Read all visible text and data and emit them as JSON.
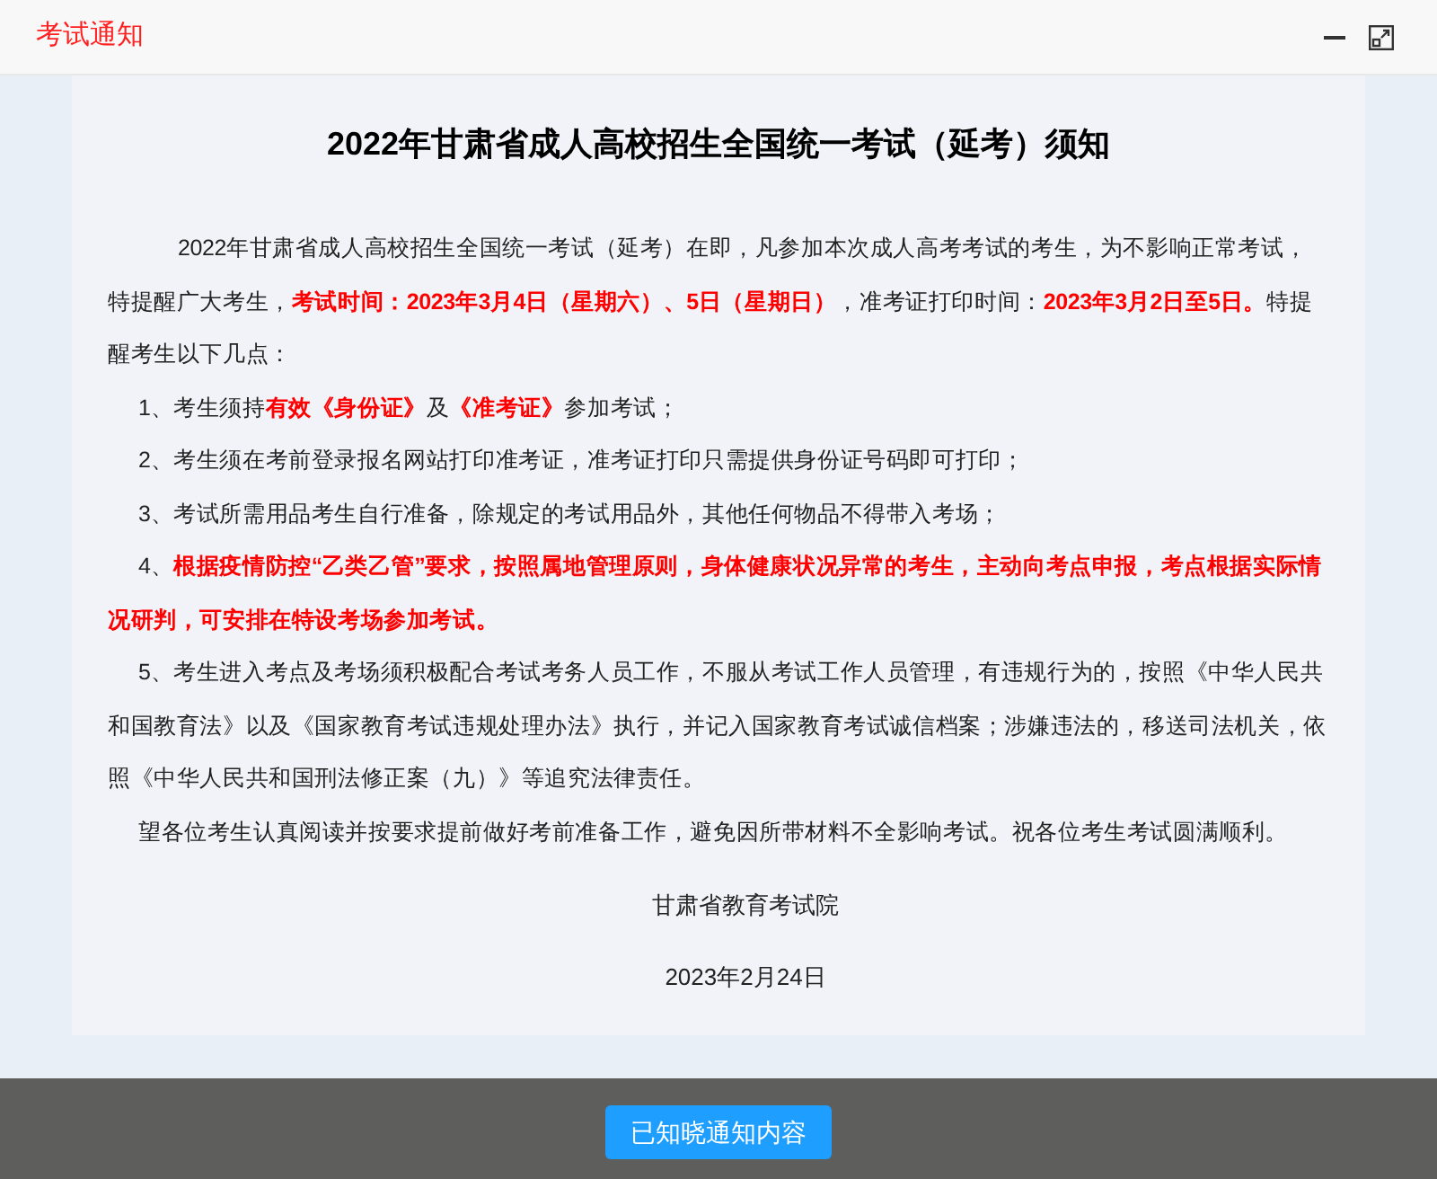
{
  "dialog": {
    "title": "考试通知",
    "controls": [
      {
        "kind": "minimize"
      },
      {
        "kind": "maximize"
      }
    ]
  },
  "notice": {
    "heading": "2022年甘肃省成人高校招生全国统一考试（延考）须知",
    "paragraphs": [
      {
        "kind": "intro",
        "segments": [
          {
            "text": "2022年甘肃省成人高校招生全国统一考试（延考）在即，凡参加本次成人高考考试的考生，为不影响正常考试，特提醒广大考生，",
            "red": false
          },
          {
            "text": "考试时间：2023年3月4日（星期六）、5日（星期日）",
            "red": true
          },
          {
            "text": "，准考证打印时间：",
            "red": false
          },
          {
            "text": "2023年3月2日至5日。",
            "red": true
          },
          {
            "text": "特提醒考生以下几点：",
            "red": false
          }
        ]
      },
      {
        "kind": "item",
        "segments": [
          {
            "text": "1、考生须持",
            "red": false
          },
          {
            "text": "有效《身份证》",
            "red": true
          },
          {
            "text": "及",
            "red": false
          },
          {
            "text": "《准考证》",
            "red": true
          },
          {
            "text": "参加考试；",
            "red": false
          }
        ]
      },
      {
        "kind": "item",
        "segments": [
          {
            "text": "2、考生须在考前登录报名网站打印准考证，准考证打印只需提供身份证号码即可打印；",
            "red": false
          }
        ]
      },
      {
        "kind": "item",
        "segments": [
          {
            "text": "3、考试所需用品考生自行准备，除规定的考试用品外，其他任何物品不得带入考场；",
            "red": false
          }
        ]
      },
      {
        "kind": "item",
        "segments": [
          {
            "text": "4、",
            "red": false
          },
          {
            "text": "根据疫情防控“乙类乙管”要求，按照属地管理原则，身体健康状况异常的考生，主动向考点申报，考点根据实际情况研判，可安排在特设考场参加考试。",
            "red": true
          }
        ]
      },
      {
        "kind": "item",
        "segments": [
          {
            "text": "5、考生进入考点及考场须积极配合考试考务人员工作，不服从考试工作人员管理，有违规行为的，按照《中华人民共和国教育法》以及《国家教育考试违规处理办法》执行，并记入国家教育考试诚信档案；涉嫌违法的，移送司法机关，依照《中华人民共和国刑法修正案（九）》等追究法律责任。",
            "red": false
          }
        ]
      },
      {
        "kind": "item",
        "segments": [
          {
            "text": "望各位考生认真阅读并按要求提前做好考前准备工作，避免因所带材料不全影响考试。祝各位考生考试圆满顺利。",
            "red": false
          }
        ]
      }
    ],
    "issuer": "甘肃省教育考试院",
    "date": "2023年2月24日"
  },
  "confirm_button": "已知晓通知内容"
}
